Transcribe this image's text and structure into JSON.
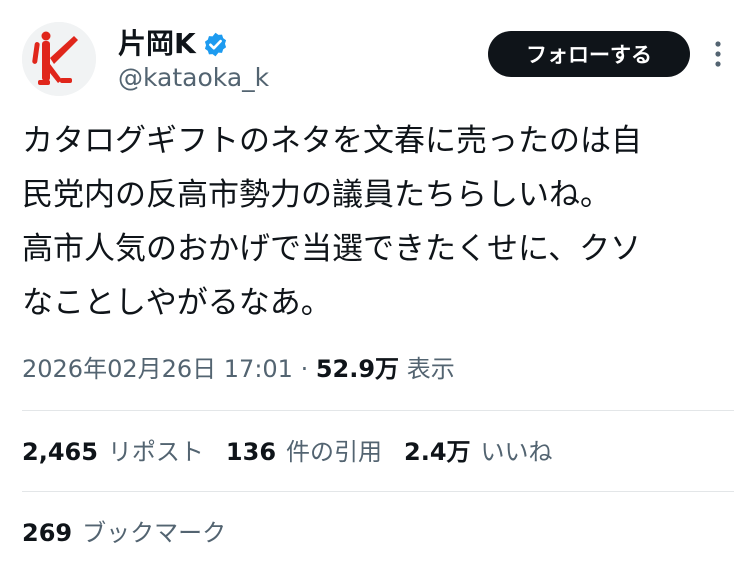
{
  "colors": {
    "text_primary": "#0f1419",
    "text_secondary": "#536471",
    "verified_blue": "#1d9bf0",
    "button_bg": "#0f1419",
    "divider": "#e3e6e8",
    "avatar_figure": "#e0261b"
  },
  "icons": {
    "verified": "verified-badge-icon",
    "more": "more-vertical-icon"
  },
  "author": {
    "display_name": "片岡K",
    "handle": "@kataoka_k",
    "verified": true
  },
  "actions": {
    "follow_label": "フォローする"
  },
  "tweet": {
    "text": "カタログギフトのネタを文春に売ったのは自\n民党内の反高市勢力の議員たちらしいね。\n高市人気のおかげで当選できたくせに、クソ\nなことしやがるなあ。"
  },
  "meta": {
    "timestamp": "2026年02月26日 17:01",
    "separator": " · ",
    "views_count": "52.9万",
    "views_label": "表示"
  },
  "stats": {
    "reposts_count": "2,465",
    "reposts_label": "リポスト",
    "quotes_count": "136",
    "quotes_label": "件の引用",
    "likes_count": "2.4万",
    "likes_label": "いいね",
    "bookmarks_count": "269",
    "bookmarks_label": "ブックマーク"
  }
}
